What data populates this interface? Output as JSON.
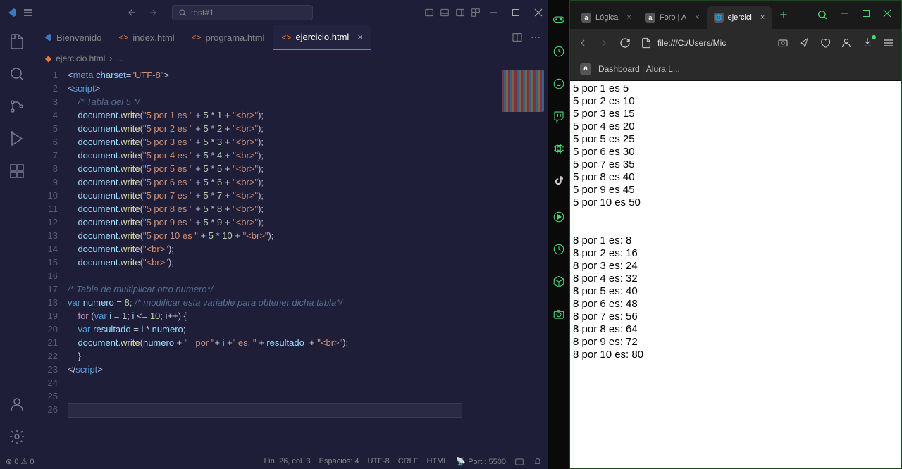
{
  "vscode": {
    "search_placeholder": "test#1",
    "tabs": [
      {
        "label": "Bienvenido",
        "active": false,
        "icon": "vscode"
      },
      {
        "label": "index.html",
        "active": false,
        "icon": "html"
      },
      {
        "label": "programa.html",
        "active": false,
        "icon": "html"
      },
      {
        "label": "ejercicio.html",
        "active": true,
        "icon": "html"
      }
    ],
    "breadcrumb": [
      "ejercicio.html",
      "..."
    ],
    "lines": [
      {
        "n": 1,
        "html": "<span class='t-punc'>&lt;</span><span class='t-tag'>meta</span> <span class='t-attr'>charset</span><span class='t-punc'>=</span><span class='t-str'>\"UTF-8\"</span><span class='t-punc'>&gt;</span>"
      },
      {
        "n": 2,
        "html": "<span class='t-punc'>&lt;</span><span class='t-tag'>script</span><span class='t-punc'>&gt;</span>"
      },
      {
        "n": 3,
        "html": "    <span class='t-comment'>/* Tabla del 5 */</span>"
      },
      {
        "n": 4,
        "html": "    <span class='t-obj'>document</span><span class='t-punc'>.</span><span class='t-method'>write</span><span class='t-punc'>(</span><span class='t-str'>\"5 por 1 es \"</span> <span class='t-punc'>+</span> <span class='t-num'>5</span> <span class='t-punc'>*</span> <span class='t-num'>1</span> <span class='t-punc'>+</span> <span class='t-str'>\"&lt;br&gt;\"</span><span class='t-punc'>);</span>"
      },
      {
        "n": 5,
        "html": "    <span class='t-obj'>document</span><span class='t-punc'>.</span><span class='t-method'>write</span><span class='t-punc'>(</span><span class='t-str'>\"5 por 2 es \"</span> <span class='t-punc'>+</span> <span class='t-num'>5</span> <span class='t-punc'>*</span> <span class='t-num'>2</span> <span class='t-punc'>+</span> <span class='t-str'>\"&lt;br&gt;\"</span><span class='t-punc'>);</span>"
      },
      {
        "n": 6,
        "html": "    <span class='t-obj'>document</span><span class='t-punc'>.</span><span class='t-method'>write</span><span class='t-punc'>(</span><span class='t-str'>\"5 por 3 es \"</span> <span class='t-punc'>+</span> <span class='t-num'>5</span> <span class='t-punc'>*</span> <span class='t-num'>3</span> <span class='t-punc'>+</span> <span class='t-str'>\"&lt;br&gt;\"</span><span class='t-punc'>);</span>"
      },
      {
        "n": 7,
        "html": "    <span class='t-obj'>document</span><span class='t-punc'>.</span><span class='t-method'>write</span><span class='t-punc'>(</span><span class='t-str'>\"5 por 4 es \"</span> <span class='t-punc'>+</span> <span class='t-num'>5</span> <span class='t-punc'>*</span> <span class='t-num'>4</span> <span class='t-punc'>+</span> <span class='t-str'>\"&lt;br&gt;\"</span><span class='t-punc'>);</span>"
      },
      {
        "n": 8,
        "html": "    <span class='t-obj'>document</span><span class='t-punc'>.</span><span class='t-method'>write</span><span class='t-punc'>(</span><span class='t-str'>\"5 por 5 es \"</span> <span class='t-punc'>+</span> <span class='t-num'>5</span> <span class='t-punc'>*</span> <span class='t-num'>5</span> <span class='t-punc'>+</span> <span class='t-str'>\"&lt;br&gt;\"</span><span class='t-punc'>);</span>"
      },
      {
        "n": 9,
        "html": "    <span class='t-obj'>document</span><span class='t-punc'>.</span><span class='t-method'>write</span><span class='t-punc'>(</span><span class='t-str'>\"5 por 6 es \"</span> <span class='t-punc'>+</span> <span class='t-num'>5</span> <span class='t-punc'>*</span> <span class='t-num'>6</span> <span class='t-punc'>+</span> <span class='t-str'>\"&lt;br&gt;\"</span><span class='t-punc'>);</span>"
      },
      {
        "n": 10,
        "html": "    <span class='t-obj'>document</span><span class='t-punc'>.</span><span class='t-method'>write</span><span class='t-punc'>(</span><span class='t-str'>\"5 por 7 es \"</span> <span class='t-punc'>+</span> <span class='t-num'>5</span> <span class='t-punc'>*</span> <span class='t-num'>7</span> <span class='t-punc'>+</span> <span class='t-str'>\"&lt;br&gt;\"</span><span class='t-punc'>);</span>"
      },
      {
        "n": 11,
        "html": "    <span class='t-obj'>document</span><span class='t-punc'>.</span><span class='t-method'>write</span><span class='t-punc'>(</span><span class='t-str'>\"5 por 8 es \"</span> <span class='t-punc'>+</span> <span class='t-num'>5</span> <span class='t-punc'>*</span> <span class='t-num'>8</span> <span class='t-punc'>+</span> <span class='t-str'>\"&lt;br&gt;\"</span><span class='t-punc'>);</span>"
      },
      {
        "n": 12,
        "html": "    <span class='t-obj'>document</span><span class='t-punc'>.</span><span class='t-method'>write</span><span class='t-punc'>(</span><span class='t-str'>\"5 por 9 es \"</span> <span class='t-punc'>+</span> <span class='t-num'>5</span> <span class='t-punc'>*</span> <span class='t-num'>9</span> <span class='t-punc'>+</span> <span class='t-str'>\"&lt;br&gt;\"</span><span class='t-punc'>);</span>"
      },
      {
        "n": 13,
        "html": "    <span class='t-obj'>document</span><span class='t-punc'>.</span><span class='t-method'>write</span><span class='t-punc'>(</span><span class='t-str'>\"5 por 10 es \"</span> <span class='t-punc'>+</span> <span class='t-num'>5</span> <span class='t-punc'>*</span> <span class='t-num'>10</span> <span class='t-punc'>+</span> <span class='t-str'>\"&lt;br&gt;\"</span><span class='t-punc'>);</span>"
      },
      {
        "n": 14,
        "html": "    <span class='t-obj'>document</span><span class='t-punc'>.</span><span class='t-method'>write</span><span class='t-punc'>(</span><span class='t-str'>\"&lt;br&gt;\"</span><span class='t-punc'>);</span>"
      },
      {
        "n": 15,
        "html": "    <span class='t-obj'>document</span><span class='t-punc'>.</span><span class='t-method'>write</span><span class='t-punc'>(</span><span class='t-str'>\"&lt;br&gt;\"</span><span class='t-punc'>);</span>"
      },
      {
        "n": 16,
        "html": ""
      },
      {
        "n": 17,
        "html": "<span class='t-comment'>/* Tabla de multiplicar otro numero*/</span>"
      },
      {
        "n": 18,
        "html": "<span class='t-var'>var</span> <span class='t-varname'>numero</span> <span class='t-punc'>=</span> <span class='t-num'>8</span><span class='t-punc'>;</span> <span class='t-comment'>/* modificar esta variable para obtener dicha tabla*/</span>"
      },
      {
        "n": 19,
        "html": "    <span class='t-kw'>for</span> <span class='t-punc'>(</span><span class='t-var'>var</span> <span class='t-varname'>i</span> <span class='t-punc'>=</span> <span class='t-num'>1</span><span class='t-punc'>;</span> <span class='t-varname'>i</span> <span class='t-punc'>&lt;=</span> <span class='t-num'>10</span><span class='t-punc'>;</span> <span class='t-varname'>i</span><span class='t-punc'>++) {</span>"
      },
      {
        "n": 20,
        "html": "    <span class='t-var'>var</span> <span class='t-varname'>resultado</span> <span class='t-punc'>=</span> <span class='t-varname'>i</span> <span class='t-punc'>*</span> <span class='t-varname'>numero</span><span class='t-punc'>;</span>"
      },
      {
        "n": 21,
        "html": "    <span class='t-obj'>document</span><span class='t-punc'>.</span><span class='t-method'>write</span><span class='t-punc'>(</span><span class='t-varname'>numero</span> <span class='t-punc'>+</span> <span class='t-str'>\"   por \"</span><span class='t-punc'>+</span> <span class='t-varname'>i</span> <span class='t-punc'>+</span><span class='t-str'>\" es: \"</span> <span class='t-punc'>+</span> <span class='t-varname'>resultado</span>  <span class='t-punc'>+</span> <span class='t-str'>\"&lt;br&gt;\"</span><span class='t-punc'>);</span>"
      },
      {
        "n": 22,
        "html": "    <span class='t-punc'>}</span>"
      },
      {
        "n": 23,
        "html": "<span class='t-punc'>&lt;/</span><span class='t-tag'>script</span><span class='t-punc'>&gt;</span>"
      },
      {
        "n": 24,
        "html": ""
      },
      {
        "n": 25,
        "html": ""
      },
      {
        "n": 26,
        "html": "",
        "cursor": true
      }
    ],
    "status": {
      "errors": "0",
      "warnings": "0",
      "ln_col": "Lín. 26, col. 3",
      "spaces": "Espacios: 4",
      "encoding": "UTF-8",
      "eol": "CRLF",
      "lang": "HTML",
      "port": "Port : 5500"
    }
  },
  "browser": {
    "tabs": [
      {
        "label": "Lógica",
        "active": false
      },
      {
        "label": "Foro | A",
        "active": false
      },
      {
        "label": "ejercici",
        "active": true
      }
    ],
    "address": "file:///C:/Users/Mic",
    "fav_title": "Dashboard | Alura L...",
    "page_lines": [
      "5 por 1 es 5",
      "5 por 2 es 10",
      "5 por 3 es 15",
      "5 por 4 es 20",
      "5 por 5 es 25",
      "5 por 6 es 30",
      "5 por 7 es 35",
      "5 por 8 es 40",
      "5 por 9 es 45",
      "5 por 10 es 50",
      "",
      "",
      "8 por 1 es: 8",
      "8 por 2 es: 16",
      "8 por 3 es: 24",
      "8 por 4 es: 32",
      "8 por 5 es: 40",
      "8 por 6 es: 48",
      "8 por 7 es: 56",
      "8 por 8 es: 64",
      "8 por 9 es: 72",
      "8 por 10 es: 80"
    ]
  }
}
